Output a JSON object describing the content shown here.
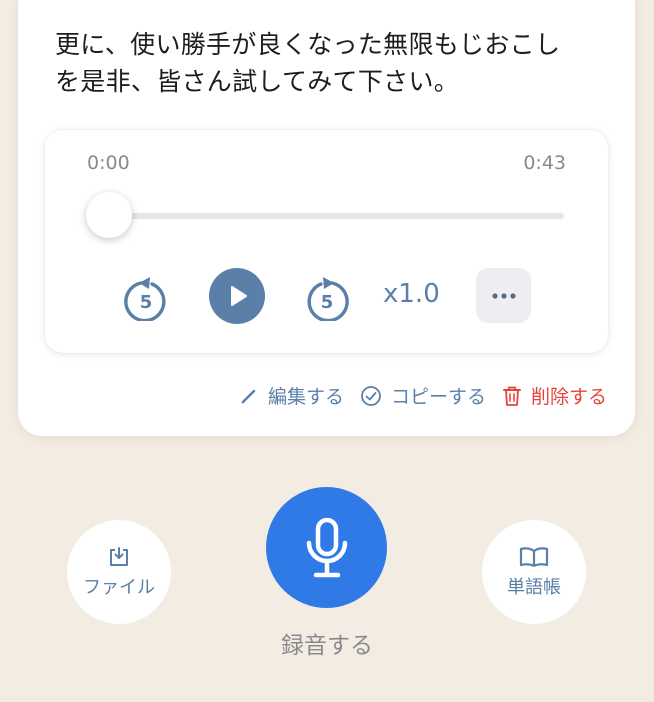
{
  "transcript": {
    "text": "更に、使い勝手が良くなった無限もじおこし\nを是非、皆さん試してみて下さい。"
  },
  "player": {
    "current_time": "0:00",
    "total_time": "0:43",
    "progress": 0.0,
    "skip_back_seconds": "5",
    "skip_forward_seconds": "5",
    "speed": "x1.0",
    "more_label": "•••"
  },
  "actions": {
    "edit_label": "編集する",
    "copy_label": "コピーする",
    "delete_label": "削除する"
  },
  "bottom": {
    "file_label": "ファイル",
    "record_label": "録音する",
    "vocab_label": "単語帳"
  },
  "colors": {
    "background": "#f3ece2",
    "accent": "#5a80aa",
    "record": "#2f7ae6",
    "delete": "#e2453c"
  },
  "icons": {
    "skip_back": "replay-5-icon",
    "play": "play-icon",
    "skip_forward": "forward-5-icon",
    "more": "more-horizontal-icon",
    "edit": "pencil-icon",
    "copy": "check-circle-icon",
    "delete": "trash-icon",
    "file": "download-tray-icon",
    "record": "microphone-icon",
    "vocab": "book-icon"
  }
}
